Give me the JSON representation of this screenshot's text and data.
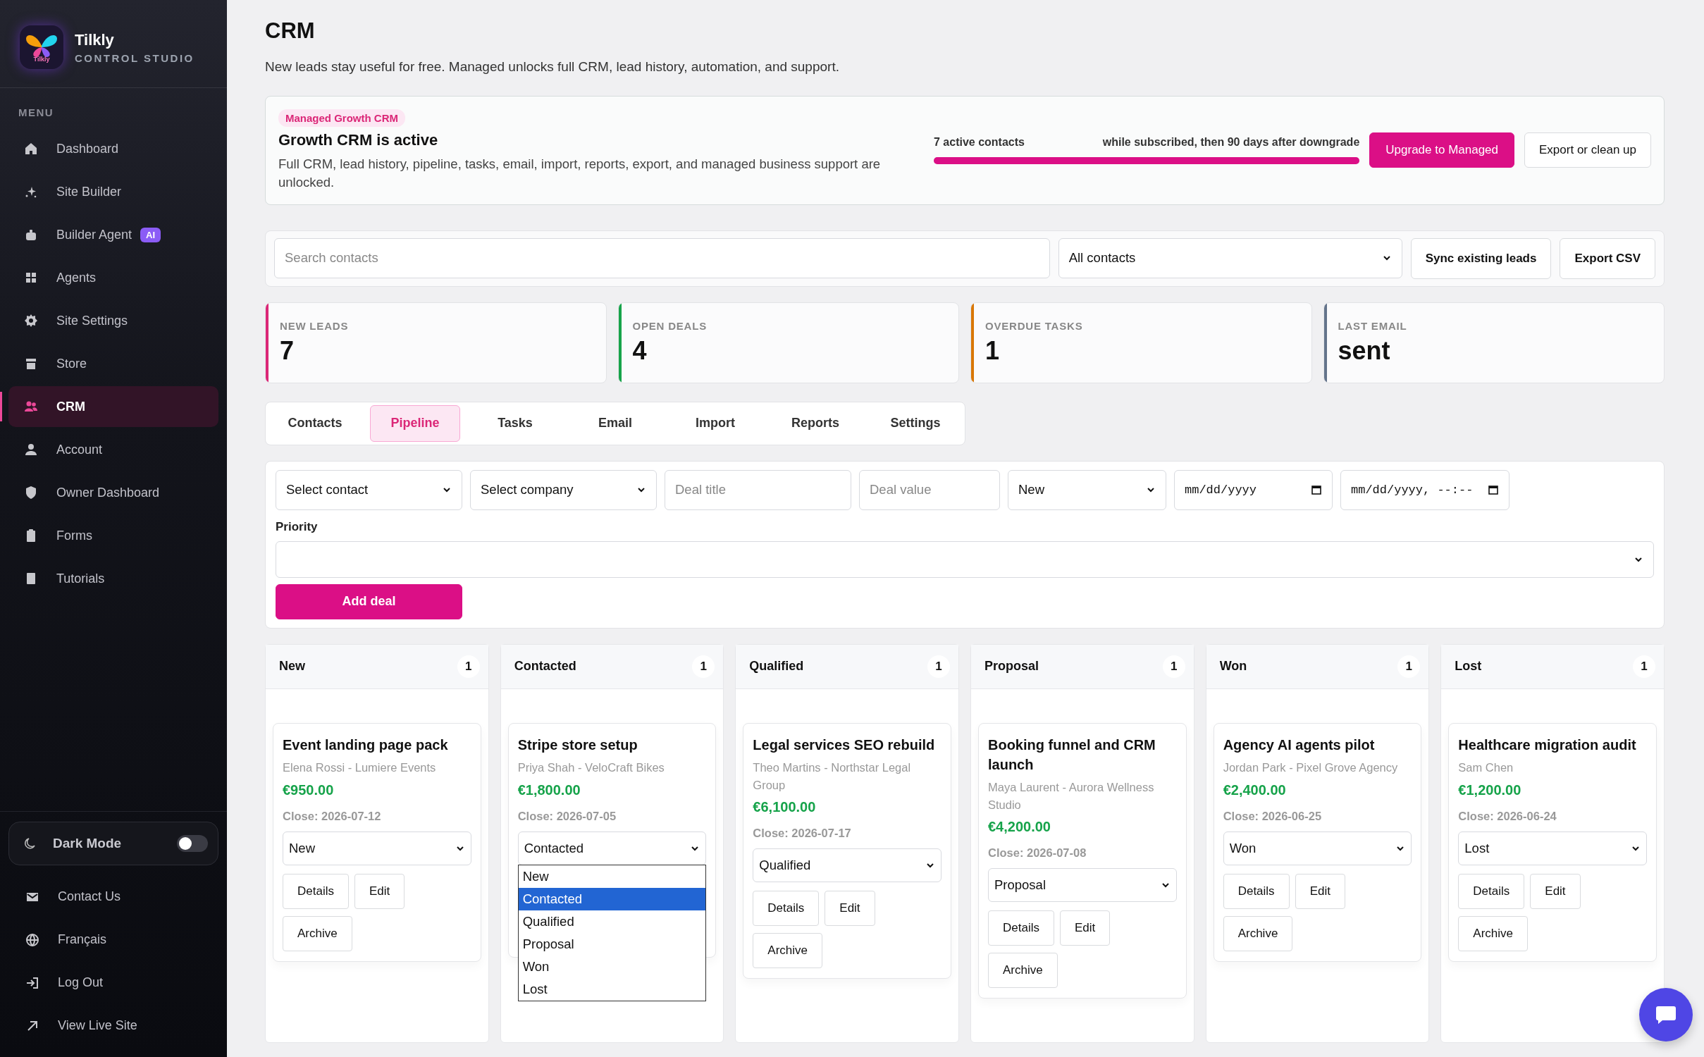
{
  "sidebar": {
    "brand": {
      "name": "Tilkly",
      "tagline": "CONTROL STUDIO",
      "logo_text": "Tilkly"
    },
    "menu_label": "MENU",
    "items": [
      {
        "label": "Dashboard",
        "selected": false
      },
      {
        "label": "Site Builder",
        "selected": false
      },
      {
        "label": "Builder Agent",
        "badge": "AI",
        "selected": false
      },
      {
        "label": "Agents",
        "selected": false
      },
      {
        "label": "Site Settings",
        "selected": false
      },
      {
        "label": "Store",
        "selected": false
      },
      {
        "label": "CRM",
        "selected": true
      },
      {
        "label": "Account",
        "selected": false
      },
      {
        "label": "Owner Dashboard",
        "selected": false
      },
      {
        "label": "Forms",
        "selected": false
      },
      {
        "label": "Tutorials",
        "selected": false
      }
    ],
    "dark_mode": {
      "label": "Dark Mode",
      "on": false
    },
    "footer_items": [
      {
        "label": "Contact Us"
      },
      {
        "label": "Français"
      },
      {
        "label": "Log Out"
      },
      {
        "label": "View Live Site"
      }
    ]
  },
  "page": {
    "title": "CRM",
    "subtitle": "New leads stay useful for free. Managed unlocks full CRM, lead history, automation, and support."
  },
  "plan_banner": {
    "badge": "Managed Growth CRM",
    "title": "Growth CRM is active",
    "description": "Full CRM, lead history, pipeline, tasks, email, import, reports, export, and managed business support are unlocked.",
    "usage_label": "7 active contacts",
    "usage_note": "while subscribed, then 90 days after downgrade",
    "level": 1,
    "buttons": [
      {
        "label": "Upgrade to Managed",
        "kind": "primary"
      },
      {
        "label": "Export or clean up",
        "kind": "secondary"
      }
    ]
  },
  "toolbar": {
    "search": {
      "placeholder": "Search contacts"
    },
    "filter": {
      "value": "All contacts"
    },
    "buttons": [
      "Sync existing leads",
      "Export CSV"
    ]
  },
  "stats": [
    {
      "label": "NEW LEADS",
      "value": "7",
      "color": "#db2777"
    },
    {
      "label": "OPEN DEALS",
      "value": "4",
      "color": "#16a34a"
    },
    {
      "label": "OVERDUE TASKS",
      "value": "1",
      "color": "#d97706"
    },
    {
      "label": "LAST EMAIL",
      "value": "sent",
      "color": "#64748b"
    }
  ],
  "tabs": [
    {
      "label": "Contacts",
      "selected": false
    },
    {
      "label": "Pipeline",
      "selected": true
    },
    {
      "label": "Tasks",
      "selected": false
    },
    {
      "label": "Email",
      "selected": false
    },
    {
      "label": "Import",
      "selected": false
    },
    {
      "label": "Reports",
      "selected": false
    },
    {
      "label": "Settings",
      "selected": false
    }
  ],
  "deal_form": {
    "fields": [
      {
        "kind": "select",
        "value": "Select contact"
      },
      {
        "kind": "select",
        "value": "Select company"
      },
      {
        "kind": "input",
        "placeholder": "Deal title"
      },
      {
        "kind": "input",
        "placeholder": "Deal value"
      },
      {
        "kind": "select",
        "value": "New"
      },
      {
        "kind": "date",
        "value": "mm/dd/yyyy"
      },
      {
        "kind": "date",
        "value": "mm/dd/yyyy, --:--"
      }
    ],
    "priority_label": "Priority",
    "submit": "Add deal"
  },
  "pipeline": [
    {
      "stage": "New",
      "count": "1",
      "deals": [
        {
          "title": "Event landing page pack",
          "contact": "Elena Rossi - Lumiere Events",
          "value": "€950.00",
          "close": "Close: 2026-07-12",
          "status": "New",
          "buttons": [
            "Details",
            "Edit",
            "Archive"
          ]
        }
      ]
    },
    {
      "stage": "Contacted",
      "count": "1",
      "deals": [
        {
          "title": "Stripe store setup",
          "contact": "Priya Shah - VeloCraft Bikes",
          "value": "€1,800.00",
          "close": "Close: 2026-07-05",
          "status": "Contacted",
          "open_options": [
            {
              "label": "New",
              "selected": false
            },
            {
              "label": "Contacted",
              "selected": true
            },
            {
              "label": "Qualified",
              "selected": false
            },
            {
              "label": "Proposal",
              "selected": false
            },
            {
              "label": "Won",
              "selected": false
            },
            {
              "label": "Lost",
              "selected": false
            }
          ]
        }
      ]
    },
    {
      "stage": "Qualified",
      "count": "1",
      "deals": [
        {
          "title": "Legal services SEO rebuild",
          "contact": "Theo Martins - Northstar Legal Group",
          "value": "€6,100.00",
          "close": "Close: 2026-07-17",
          "status": "Qualified",
          "buttons": [
            "Details",
            "Edit",
            "Archive"
          ]
        }
      ]
    },
    {
      "stage": "Proposal",
      "count": "1",
      "deals": [
        {
          "title": "Booking funnel and CRM launch",
          "contact": "Maya Laurent - Aurora Wellness Studio",
          "value": "€4,200.00",
          "close": "Close: 2026-07-08",
          "status": "Proposal",
          "buttons": [
            "Details",
            "Edit",
            "Archive"
          ]
        }
      ]
    },
    {
      "stage": "Won",
      "count": "1",
      "deals": [
        {
          "title": "Agency AI agents pilot",
          "contact": "Jordan Park - Pixel Grove Agency",
          "value": "€2,400.00",
          "close": "Close: 2026-06-25",
          "status": "Won",
          "buttons": [
            "Details",
            "Edit",
            "Archive"
          ]
        }
      ]
    },
    {
      "stage": "Lost",
      "count": "1",
      "deals": [
        {
          "title": "Healthcare migration audit",
          "contact": "Sam Chen",
          "value": "€1,200.00",
          "close": "Close: 2026-06-24",
          "status": "Lost",
          "buttons": [
            "Details",
            "Edit",
            "Archive"
          ]
        }
      ]
    }
  ]
}
